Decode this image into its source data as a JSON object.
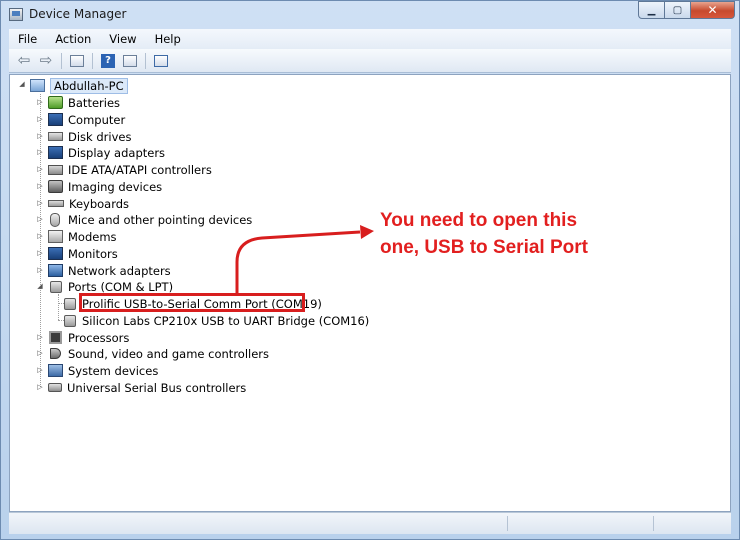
{
  "window": {
    "title": "Device Manager",
    "minimize_icon": "minimize-icon",
    "maximize_icon": "maximize-icon",
    "close_icon": "close-icon",
    "close_glyph": "✕",
    "minimize_glyph": "▁",
    "maximize_glyph": "▢"
  },
  "menu": [
    "File",
    "Action",
    "View",
    "Help"
  ],
  "toolbar": {
    "buttons": [
      "back-icon",
      "forward-icon",
      "properties-icon",
      "help-icon",
      "show-hide-console-tree-icon",
      "scan-hardware-icon"
    ],
    "help_glyph": "?",
    "back_glyph": "⇦",
    "forward_glyph": "⇨"
  },
  "tree": {
    "root": "Abdullah-PC",
    "categories": [
      {
        "label": "Batteries",
        "icon": "battery-icon"
      },
      {
        "label": "Computer",
        "icon": "computer-icon"
      },
      {
        "label": "Disk drives",
        "icon": "disk-drive-icon"
      },
      {
        "label": "Display adapters",
        "icon": "display-adapter-icon"
      },
      {
        "label": "IDE ATA/ATAPI controllers",
        "icon": "ide-controller-icon"
      },
      {
        "label": "Imaging devices",
        "icon": "camera-icon"
      },
      {
        "label": "Keyboards",
        "icon": "keyboard-icon"
      },
      {
        "label": "Mice and other pointing devices",
        "icon": "mouse-icon"
      },
      {
        "label": "Modems",
        "icon": "modem-icon"
      },
      {
        "label": "Monitors",
        "icon": "monitor-icon"
      },
      {
        "label": "Network adapters",
        "icon": "network-adapter-icon"
      },
      {
        "label": "Ports (COM & LPT)",
        "icon": "port-icon",
        "expanded": true,
        "children": [
          {
            "label": "Prolific USB-to-Serial Comm Port (COM19)",
            "icon": "port-icon"
          },
          {
            "label": "Silicon Labs CP210x USB to UART Bridge (COM16)",
            "icon": "port-icon"
          }
        ]
      },
      {
        "label": "Processors",
        "icon": "processor-icon"
      },
      {
        "label": "Sound, video and game controllers",
        "icon": "speaker-icon"
      },
      {
        "label": "System devices",
        "icon": "system-devices-icon"
      },
      {
        "label": "Universal Serial Bus controllers",
        "icon": "usb-icon"
      }
    ]
  },
  "annotation": {
    "line1": "You need to open this",
    "line2": "one, USB to Serial Port",
    "color": "#e21f1f"
  }
}
